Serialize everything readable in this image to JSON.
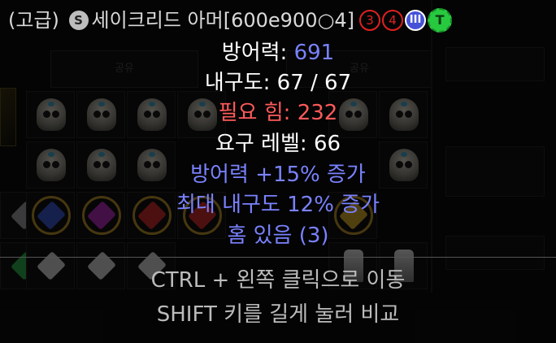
{
  "item": {
    "quality": "(고급)",
    "rune_icon": "S",
    "name": "세이크리드 아머[600e900○4]",
    "badges": [
      "3",
      "4"
    ],
    "tier_badge": "III",
    "type_badge": "T",
    "stats": [
      {
        "label": "방어력: ",
        "value": "691"
      },
      {
        "label": "내구도: ",
        "value": "67 / 67"
      },
      {
        "label": "필요 힘: ",
        "value": "232"
      },
      {
        "label": "요구 레벨: ",
        "value": "66"
      }
    ],
    "magic_props": [
      "방어력 +15% 증가",
      "최대 내구도 12% 증가",
      "홈 있음 (3)"
    ]
  },
  "hints": [
    "CTRL + 왼쪽 클릭으로 이동",
    "SHIFT 키를 길게 눌러 비교"
  ],
  "stash": {
    "tab_labels": [
      "공유",
      "공유"
    ]
  },
  "colors": {
    "normal_text": "#ffffff",
    "magic_blue": "#7a82ff",
    "requirement_red": "#ff5a5a",
    "hint_grey": "#bcbcbc"
  }
}
